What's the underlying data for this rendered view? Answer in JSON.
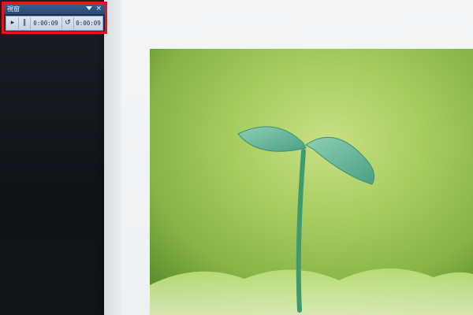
{
  "control_panel": {
    "title": "視窗",
    "elapsed_time": "0:00:09",
    "total_time": "0:00:09",
    "icons": {
      "dropdown": "dropdown-triangle-icon",
      "close": "close-icon",
      "play": "play-icon",
      "pause": "pause-icon",
      "restart": "restart-icon"
    },
    "glyphs": {
      "close": "×",
      "play": "▸",
      "pause": "∥",
      "restart": "↺"
    }
  },
  "colors": {
    "highlight_border": "#e8141a",
    "panel_title": "#294a75"
  }
}
